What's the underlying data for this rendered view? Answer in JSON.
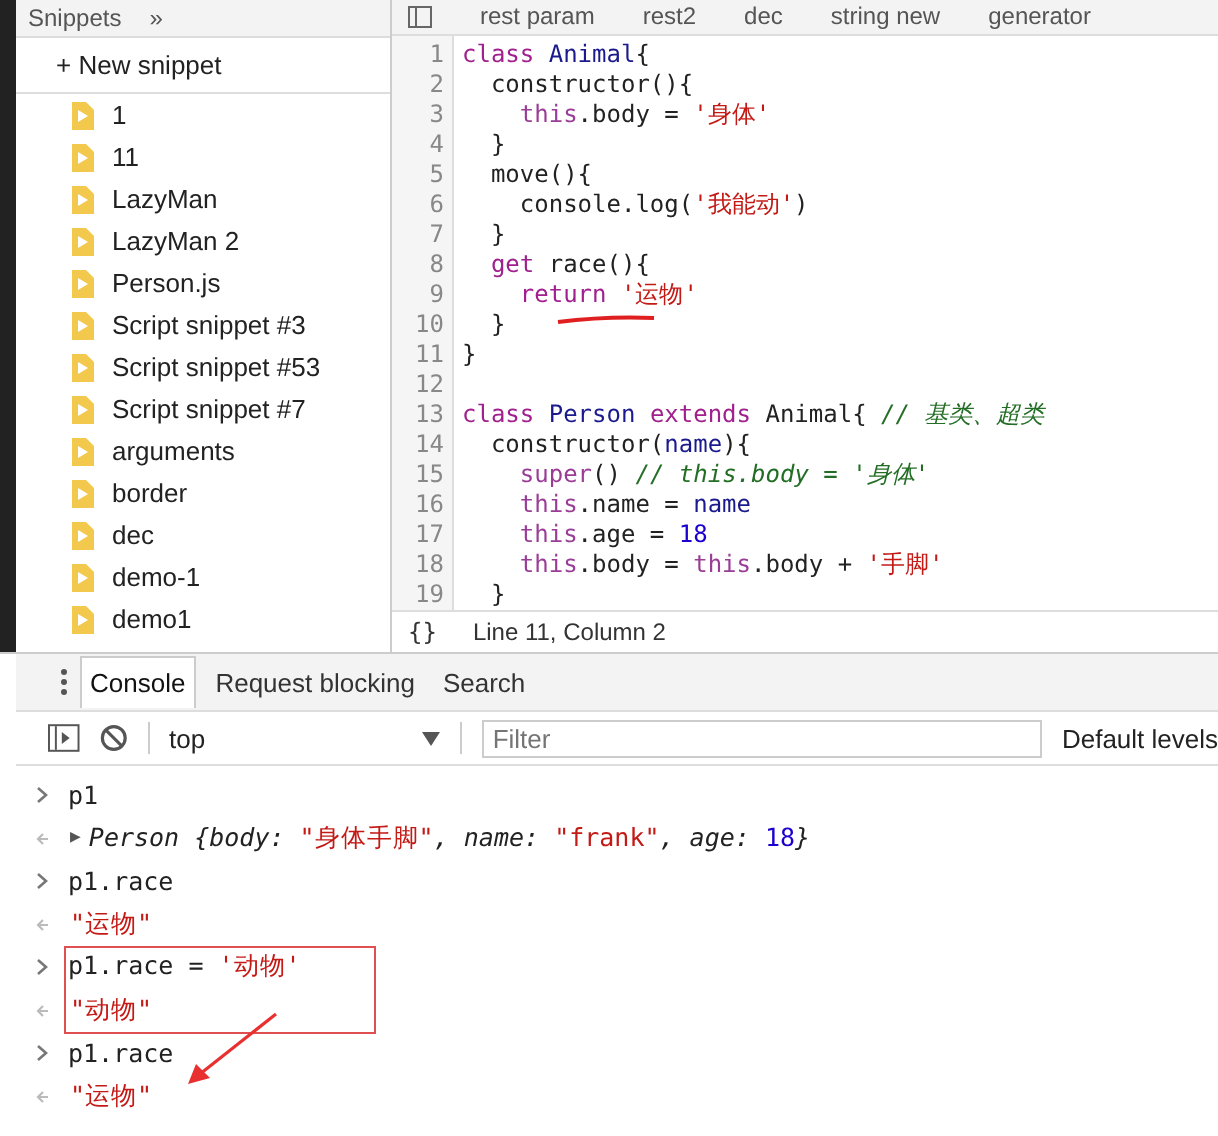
{
  "sidebar": {
    "title": "Snippets",
    "more": "»",
    "new_snippet": "+ New snippet",
    "items": [
      {
        "label": "1"
      },
      {
        "label": "11"
      },
      {
        "label": "LazyMan"
      },
      {
        "label": "LazyMan 2"
      },
      {
        "label": "Person.js"
      },
      {
        "label": "Script snippet #3"
      },
      {
        "label": "Script snippet #53"
      },
      {
        "label": "Script snippet #7"
      },
      {
        "label": "arguments"
      },
      {
        "label": "border"
      },
      {
        "label": "dec"
      },
      {
        "label": "demo-1"
      },
      {
        "label": "demo1"
      }
    ]
  },
  "editor": {
    "tabs": [
      {
        "label": "rest param",
        "selected": false
      },
      {
        "label": "rest2",
        "selected": false
      },
      {
        "label": "dec",
        "selected": false
      },
      {
        "label": "string new",
        "selected": false
      },
      {
        "label": "generator",
        "selected": false
      }
    ],
    "lines": [
      {
        "number": "1",
        "tokens": [
          {
            "text": "class ",
            "kind": "keyword"
          },
          {
            "text": "Animal",
            "kind": "def"
          },
          {
            "text": "{",
            "kind": "plain"
          }
        ]
      },
      {
        "number": "2",
        "tokens": [
          {
            "text": "  constructor(){",
            "kind": "plain"
          }
        ]
      },
      {
        "number": "3",
        "tokens": [
          {
            "text": "    this",
            "kind": "this"
          },
          {
            "text": ".body = ",
            "kind": "plain"
          },
          {
            "text": "'身体'",
            "kind": "string"
          }
        ]
      },
      {
        "number": "4",
        "tokens": [
          {
            "text": "  }",
            "kind": "plain"
          }
        ]
      },
      {
        "number": "5",
        "tokens": [
          {
            "text": "  move(){",
            "kind": "plain"
          }
        ]
      },
      {
        "number": "6",
        "tokens": [
          {
            "text": "    console.log(",
            "kind": "plain"
          },
          {
            "text": "'我能动'",
            "kind": "string"
          },
          {
            "text": ")",
            "kind": "plain"
          }
        ]
      },
      {
        "number": "7",
        "tokens": [
          {
            "text": "  }",
            "kind": "plain"
          }
        ]
      },
      {
        "number": "8",
        "tokens": [
          {
            "text": "  get ",
            "kind": "keyword"
          },
          {
            "text": "race(){",
            "kind": "plain"
          }
        ]
      },
      {
        "number": "9",
        "tokens": [
          {
            "text": "    return ",
            "kind": "keyword"
          },
          {
            "text": "'运物'",
            "kind": "string"
          }
        ]
      },
      {
        "number": "10",
        "tokens": [
          {
            "text": "  }",
            "kind": "plain"
          }
        ]
      },
      {
        "number": "11",
        "tokens": [
          {
            "text": "}",
            "kind": "plain"
          }
        ]
      },
      {
        "number": "12"
      },
      {
        "number": "13",
        "tokens": [
          {
            "text": "class ",
            "kind": "keyword"
          },
          {
            "text": "Person ",
            "kind": "def"
          },
          {
            "text": "extends ",
            "kind": "keyword"
          },
          {
            "text": "Animal{ ",
            "kind": "plain"
          },
          {
            "text": "// 基类、超类",
            "kind": "comment"
          }
        ]
      },
      {
        "number": "14",
        "tokens": [
          {
            "text": "  constructor(",
            "kind": "plain"
          },
          {
            "text": "name",
            "kind": "def"
          },
          {
            "text": "){",
            "kind": "plain"
          }
        ]
      },
      {
        "number": "15",
        "tokens": [
          {
            "text": "    super",
            "kind": "this"
          },
          {
            "text": "() ",
            "kind": "plain"
          },
          {
            "text": "// this.body = '身体'",
            "kind": "comment"
          }
        ]
      },
      {
        "number": "16",
        "tokens": [
          {
            "text": "    this",
            "kind": "this"
          },
          {
            "text": ".name = ",
            "kind": "plain"
          },
          {
            "text": "name",
            "kind": "def"
          }
        ]
      },
      {
        "number": "17",
        "tokens": [
          {
            "text": "    this",
            "kind": "this"
          },
          {
            "text": ".age = ",
            "kind": "plain"
          },
          {
            "text": "18",
            "kind": "number"
          }
        ]
      },
      {
        "number": "18",
        "tokens": [
          {
            "text": "    this",
            "kind": "this"
          },
          {
            "text": ".body = ",
            "kind": "plain"
          },
          {
            "text": "this",
            "kind": "this"
          },
          {
            "text": ".body + ",
            "kind": "plain"
          },
          {
            "text": "'手脚'",
            "kind": "string"
          }
        ]
      },
      {
        "number": "19",
        "tokens": [
          {
            "text": "  }",
            "kind": "plain"
          }
        ]
      }
    ],
    "pretty_print": "{}",
    "status": "Line 11, Column 2"
  },
  "drawer": {
    "tabs": [
      {
        "label": "Console",
        "selected": true
      },
      {
        "label": "Request blocking",
        "selected": false
      },
      {
        "label": "Search",
        "selected": false
      }
    ]
  },
  "toolbar": {
    "context": "top",
    "filter": {
      "placeholder": "Filter"
    },
    "levels": "Default levels"
  },
  "console": [
    {
      "kind": "input",
      "tokens": [
        {
          "text": "p1",
          "kind": "plain"
        }
      ]
    },
    {
      "kind": "output",
      "expander": "▶",
      "tokens": [
        {
          "text": "Person {body: ",
          "kind": "italic"
        },
        {
          "text": "\"身体手脚\"",
          "kind": "string"
        },
        {
          "text": ", name: ",
          "kind": "italic"
        },
        {
          "text": "\"frank\"",
          "kind": "string"
        },
        {
          "text": ", age: ",
          "kind": "italic"
        },
        {
          "text": "18",
          "kind": "number"
        },
        {
          "text": "}",
          "kind": "italic"
        }
      ]
    },
    {
      "kind": "input",
      "tokens": [
        {
          "text": "p1.race",
          "kind": "plain"
        }
      ]
    },
    {
      "kind": "output",
      "tokens": [
        {
          "text": "\"运物\"",
          "kind": "string"
        }
      ]
    },
    {
      "kind": "input",
      "tokens": [
        {
          "text": "p1.race = ",
          "kind": "plain"
        },
        {
          "text": "'动物'",
          "kind": "string"
        }
      ]
    },
    {
      "kind": "output",
      "tokens": [
        {
          "text": "\"动物\"",
          "kind": "string"
        }
      ]
    },
    {
      "kind": "input",
      "tokens": [
        {
          "text": "p1.race",
          "kind": "plain"
        }
      ]
    },
    {
      "kind": "output",
      "tokens": [
        {
          "text": "\"运物\"",
          "kind": "string"
        }
      ]
    }
  ]
}
